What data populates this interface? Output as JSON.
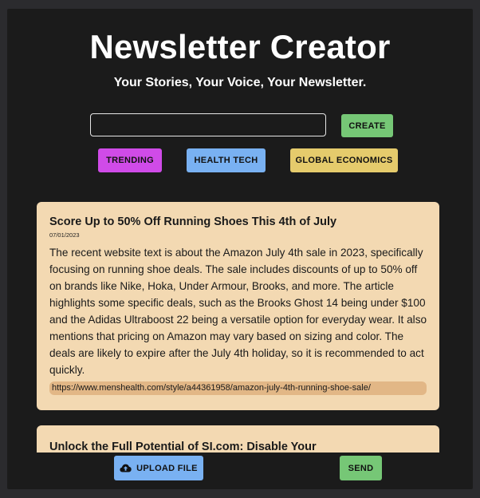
{
  "header": {
    "title": "Newsletter Creator",
    "subtitle": "Your Stories, Your Voice, Your Newsletter."
  },
  "composer": {
    "input_value": "",
    "input_placeholder": "",
    "create_label": "CREATE"
  },
  "tags": [
    {
      "label": "TRENDING",
      "color": "#d04be8"
    },
    {
      "label": "HEALTH TECH",
      "color": "#79b1f2"
    },
    {
      "label": "GLOBAL ECONOMICS",
      "color": "#e5cb6c"
    }
  ],
  "articles": [
    {
      "title": "Score Up to 50% Off Running Shoes This 4th of July",
      "date": "07/01/2023",
      "summary": "The recent website text is about the Amazon July 4th sale in 2023, specifically focusing on running shoe deals. The sale includes discounts of up to 50% off on brands like Nike, Hoka, Under Armour, Brooks, and more. The article highlights some specific deals, such as the Brooks Ghost 14 being under $100 and the Adidas Ultraboost 22 being a versatile option for everyday wear. It also mentions that pricing on Amazon may vary based on sizing and color. The deals are likely to expire after the July 4th holiday, so it is recommended to act quickly.",
      "url": "https://www.menshealth.com/style/a44361958/amazon-july-4th-running-shoe-sale/"
    },
    {
      "title": "Unlock the Full Potential of SI.com: Disable Your"
    }
  ],
  "footer": {
    "upload_label": "UPLOAD FILE",
    "upload_icon": "cloud-upload-icon",
    "send_label": "SEND"
  },
  "colors": {
    "background": "#1b1b1b",
    "card": "#f3d9b2",
    "link_highlight": "#e2b786",
    "green": "#76c776",
    "blue": "#79b1f2",
    "purple": "#d04be8",
    "yellow": "#e5cb6c"
  }
}
